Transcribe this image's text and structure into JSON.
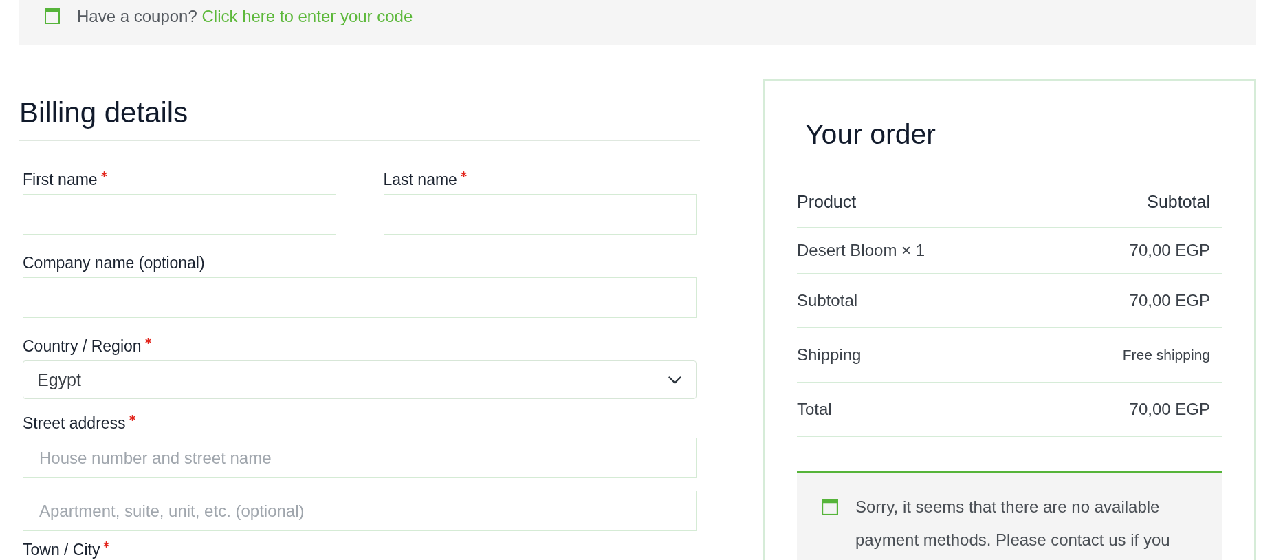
{
  "coupon_notice": {
    "text": "Have a coupon?",
    "link": "Click here to enter your code"
  },
  "billing": {
    "title": "Billing details",
    "rows": [
      [
        {
          "kind": "input",
          "label": "First name",
          "required": true
        },
        {
          "kind": "input",
          "label": "Last name",
          "required": true
        }
      ],
      [
        {
          "kind": "input",
          "label": "Company name (optional)",
          "required": false
        }
      ],
      [
        {
          "kind": "select",
          "label": "Country / Region",
          "required": true,
          "value": "Egypt"
        }
      ],
      [
        {
          "kind": "inputs",
          "label": "Street address",
          "required": true,
          "placeholders": [
            "House number and street name",
            "Apartment, suite, unit, etc. (optional)"
          ]
        }
      ],
      [
        {
          "kind": "label",
          "label": "Town / City",
          "required": true
        }
      ]
    ]
  },
  "order": {
    "title": "Your order",
    "columns": [
      "Product",
      "Subtotal"
    ],
    "rows": [
      {
        "kind": "item",
        "label": "Desert Bloom × 1",
        "value": "70,00 EGP"
      },
      {
        "kind": "subtotal",
        "label": "Subtotal",
        "value": "70,00 EGP"
      },
      {
        "kind": "shipping",
        "label": "Shipping",
        "value": "Free shipping"
      },
      {
        "kind": "total",
        "label": "Total",
        "value": "70,00 EGP"
      }
    ],
    "notice": "Sorry, it seems that there are no available payment methods. Please contact us if you"
  }
}
